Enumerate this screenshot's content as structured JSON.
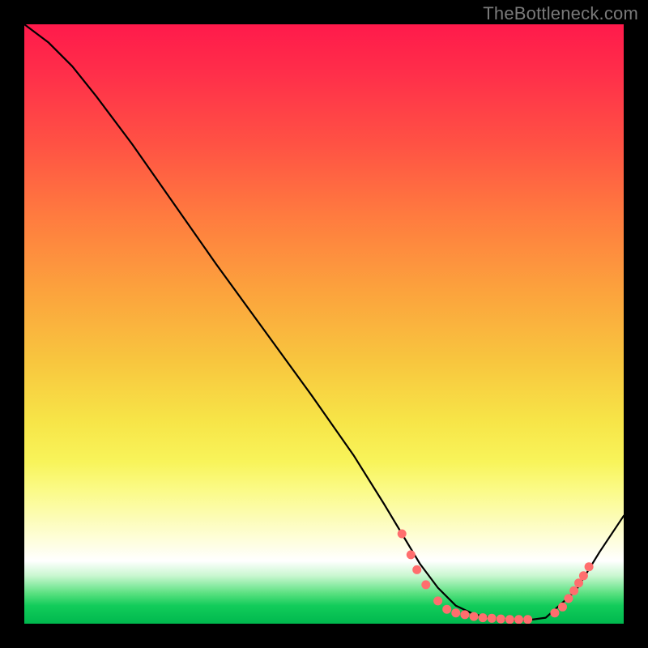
{
  "watermark": "TheBottleneck.com",
  "colors": {
    "frame_bg": "#000000",
    "line": "#000000",
    "dot": "#ff6e6e",
    "gradient": [
      "#ff1a4b",
      "#ff2e4a",
      "#ff5244",
      "#ff7b3f",
      "#fca13d",
      "#f8c53e",
      "#f7e447",
      "#f8f45a",
      "#fbfb8a",
      "#fcfcb2",
      "#fefedb",
      "#ffffff",
      "#c9f7d0",
      "#58e07f",
      "#12cc5a",
      "#00b84e"
    ]
  },
  "chart_data": {
    "type": "line",
    "title": "",
    "xlabel": "",
    "ylabel": "",
    "xlim": [
      0,
      100
    ],
    "ylim": [
      0,
      100
    ],
    "series": [
      {
        "name": "curve",
        "x": [
          0,
          4,
          8,
          12,
          18,
          25,
          32,
          40,
          48,
          55,
          60,
          63,
          66,
          69,
          72,
          75,
          78,
          81,
          84,
          87,
          92,
          96,
          100
        ],
        "y": [
          100,
          97,
          93,
          88,
          80,
          70,
          60,
          49,
          38,
          28,
          20,
          15,
          10,
          6,
          3,
          1.6,
          0.9,
          0.6,
          0.6,
          1.0,
          5.5,
          12,
          18
        ]
      }
    ],
    "markers": [
      {
        "x": 63.0,
        "y": 15.0
      },
      {
        "x": 64.5,
        "y": 11.5
      },
      {
        "x": 65.5,
        "y": 9.0
      },
      {
        "x": 67.0,
        "y": 6.5
      },
      {
        "x": 69.0,
        "y": 3.8
      },
      {
        "x": 70.5,
        "y": 2.4
      },
      {
        "x": 72.0,
        "y": 1.8
      },
      {
        "x": 73.5,
        "y": 1.5
      },
      {
        "x": 75.0,
        "y": 1.2
      },
      {
        "x": 76.5,
        "y": 1.0
      },
      {
        "x": 78.0,
        "y": 0.9
      },
      {
        "x": 79.5,
        "y": 0.8
      },
      {
        "x": 81.0,
        "y": 0.7
      },
      {
        "x": 82.5,
        "y": 0.7
      },
      {
        "x": 84.0,
        "y": 0.7
      },
      {
        "x": 88.5,
        "y": 1.8
      },
      {
        "x": 89.8,
        "y": 2.8
      },
      {
        "x": 90.8,
        "y": 4.2
      },
      {
        "x": 91.7,
        "y": 5.5
      },
      {
        "x": 92.5,
        "y": 6.8
      },
      {
        "x": 93.3,
        "y": 8.0
      },
      {
        "x": 94.2,
        "y": 9.5
      }
    ],
    "grid": false,
    "legend": false
  }
}
